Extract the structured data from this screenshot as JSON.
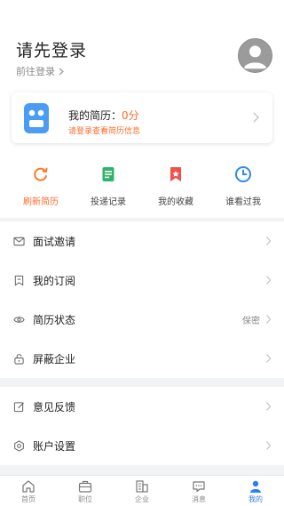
{
  "header": {
    "title": "请先登录",
    "subtitle": "前往登录",
    "avatar_icon": "user-avatar-icon"
  },
  "resume_card": {
    "label": "我的简历：",
    "score": "0分",
    "hint": "请登录查看简历信息"
  },
  "shortcuts": [
    {
      "label": "刷新简历",
      "icon": "refresh-icon",
      "active": true
    },
    {
      "label": "投递记录",
      "icon": "document-list-icon",
      "active": false
    },
    {
      "label": "我的收藏",
      "icon": "favorite-icon",
      "active": false
    },
    {
      "label": "谁看过我",
      "icon": "clock-icon",
      "active": false
    }
  ],
  "menu_group_1": [
    {
      "label": "面试邀请",
      "icon": "mail-icon",
      "value": ""
    },
    {
      "label": "我的订阅",
      "icon": "bookmark-icon",
      "value": ""
    },
    {
      "label": "简历状态",
      "icon": "eye-icon",
      "value": "保密"
    },
    {
      "label": "屏蔽企业",
      "icon": "lock-icon",
      "value": ""
    }
  ],
  "menu_group_2": [
    {
      "label": "意见反馈",
      "icon": "edit-icon",
      "value": ""
    },
    {
      "label": "账户设置",
      "icon": "settings-icon",
      "value": ""
    }
  ],
  "tabbar": [
    {
      "label": "首页",
      "icon": "home-icon",
      "active": false
    },
    {
      "label": "职位",
      "icon": "briefcase-icon",
      "active": false
    },
    {
      "label": "企业",
      "icon": "building-icon",
      "active": false
    },
    {
      "label": "消息",
      "icon": "message-icon",
      "active": false
    },
    {
      "label": "我的",
      "icon": "person-icon",
      "active": true
    }
  ],
  "colors": {
    "accent": "#ff6a2b",
    "primary": "#2f7df6",
    "background": "#f2f3f5"
  }
}
